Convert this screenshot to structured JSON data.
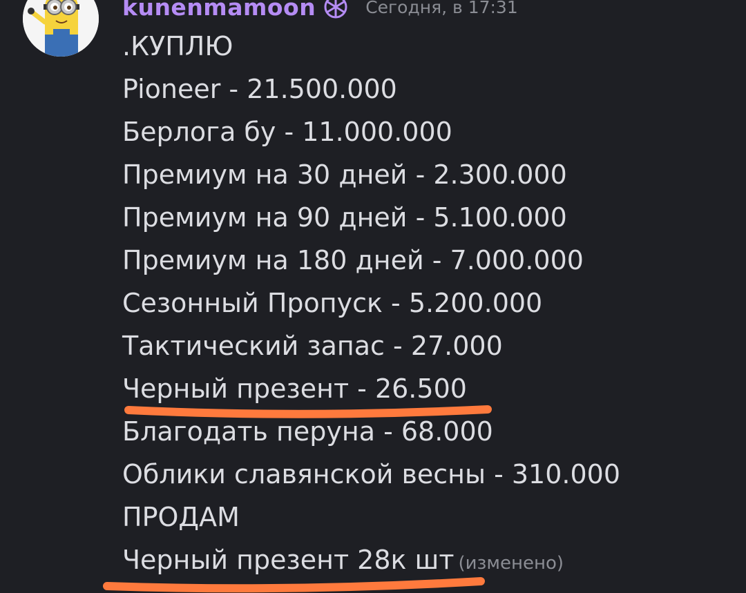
{
  "author": {
    "username": "kunenmamoon",
    "badge_icon": "crystal-badge-icon",
    "avatar_icon": "minion-avatar"
  },
  "timestamp": "Сегодня, в 17:31",
  "message": {
    "lines": [
      ".КУПЛЮ",
      "Pioneer - 21.500.000",
      "Берлога бу - 11.000.000",
      "Премиум на 30 дней - 2.300.000",
      "Премиум на 90 дней - 5.100.000",
      "Премиум на 180 дней - 7.000.000",
      "Сезонный Пропуск - 5.200.000",
      "Тактический запас - 27.000",
      "Черный презент - 26.500",
      "Благодать перуна - 68.000",
      "Облики славянской весны - 310.000",
      "ПРОДАМ",
      "Черный презент 28к шт"
    ],
    "edited_label": "(изменено)"
  },
  "colors": {
    "background": "#1e1f24",
    "username": "#b58cf4",
    "text": "#dcdde2",
    "muted": "#8b8d94",
    "annotation": "#ff7a3d"
  }
}
